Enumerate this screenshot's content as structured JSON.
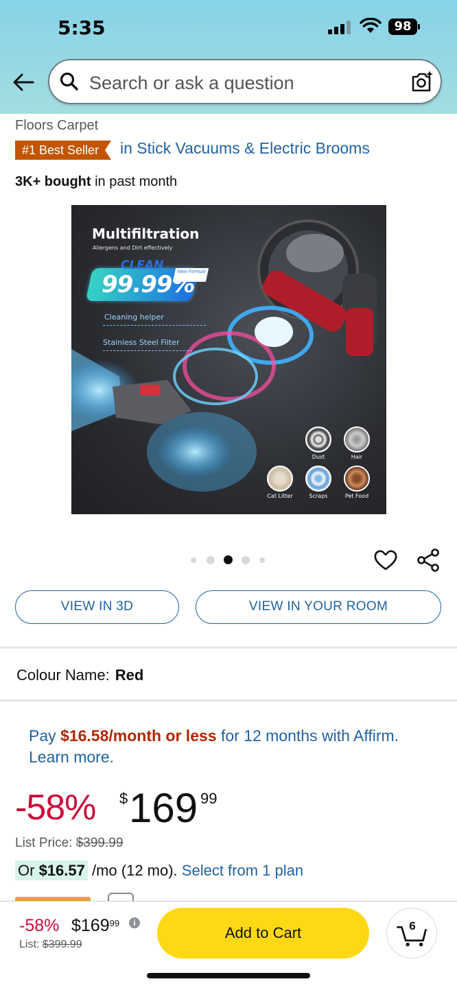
{
  "status_bar": {
    "time": "5:35",
    "battery": "98"
  },
  "header": {
    "search_placeholder": "Search or ask a question"
  },
  "product": {
    "breadcrumb_tail": "Floors Carpet",
    "best_seller_badge": "#1 Best Seller",
    "best_seller_category": "in Stick Vacuums & Electric Brooms",
    "bought_bold": "3K+ bought",
    "bought_rest": " in past month",
    "image": {
      "title": "Multifiltration",
      "subtitle": "Allergens and Dirt effectively",
      "clean_label": "CLEAN",
      "clean_percent": "99.99%",
      "new_formula": "New Formula",
      "helper_label": "Cleaning helper",
      "filter_label": "Stainless Steel Filter",
      "debris": [
        "Dust",
        "Hair",
        "Cat Litter",
        "Scraps",
        "Pet Food"
      ]
    },
    "carousel": {
      "count": 5,
      "active_index": 2
    }
  },
  "actions": {
    "view_3d": "VIEW IN 3D",
    "view_room": "VIEW IN YOUR ROOM"
  },
  "variant": {
    "label": "Colour Name:",
    "value": "Red"
  },
  "affirm": {
    "prefix": "Pay ",
    "amount": "$16.58/month or less",
    "suffix": " for 12 months with Affirm.",
    "learn_more": "Learn more."
  },
  "price": {
    "discount": "-58%",
    "currency": "$",
    "whole": "169",
    "fraction": "99",
    "list_label": "List Price: ",
    "list_value": "$399.99"
  },
  "monthly": {
    "or_label": "Or ",
    "amount": "$16.57",
    "term": " /mo (12 mo). ",
    "plan_link": "Select from 1 plan"
  },
  "bottom_bar": {
    "discount": "-58%",
    "price_whole": "$169",
    "price_fraction": "99",
    "info": "i",
    "list_label": "List: ",
    "list_value": "$399.99",
    "add_to_cart": "Add to Cart",
    "cart_count": "6"
  },
  "colors": {
    "header_bg": "#98d9e5",
    "link": "#2162a1",
    "discount": "#cc0c39",
    "best_seller": "#c45500",
    "add_to_cart": "#ffd814",
    "affirm_amount": "#b12704"
  }
}
